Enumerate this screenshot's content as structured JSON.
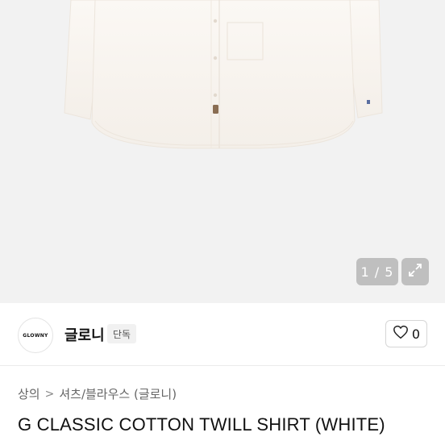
{
  "gallery": {
    "counter": "1 / 5",
    "expand_icon": "expand-icon"
  },
  "seller": {
    "logo_text": "GLOWNY",
    "name": "글로니",
    "badge": "단독",
    "like_count": "0",
    "like_icon": "heart-icon"
  },
  "breadcrumb": {
    "items": [
      "상의",
      "셔츠/블라우스 (글로니)"
    ],
    "separator": ">"
  },
  "product": {
    "title": "G CLASSIC COTTON TWILL SHIRT (WHITE)"
  },
  "colors": {
    "hero_bg": "#f2f2f2",
    "shirt": "#fbf7f2"
  }
}
